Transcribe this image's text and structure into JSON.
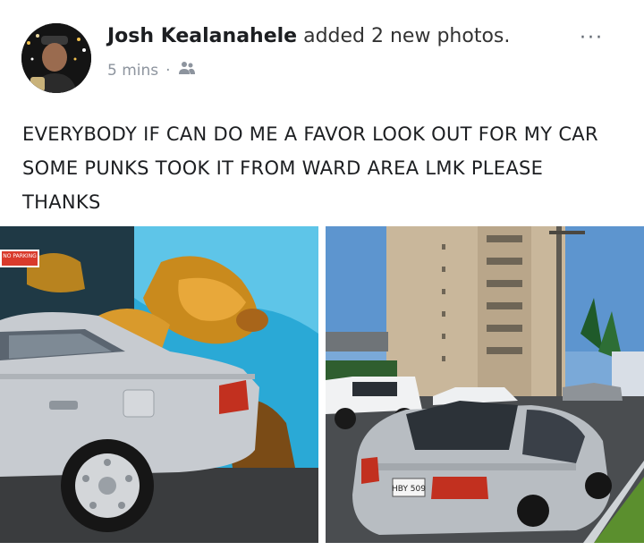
{
  "post": {
    "author": "Josh Kealanahele",
    "action": "added 2 new photos.",
    "timestamp": "5 mins",
    "separator": "·",
    "audience_icon": "friends-icon",
    "more_label": "···",
    "message": "EVERYBODY IF CAN DO ME A FAVOR LOOK OUT FOR MY CAR SOME PUNKS TOOK IT FROM WARD AREA LMK PLEASE THANKS"
  },
  "photos": {
    "left": {
      "sign_text": "NO PARKING"
    },
    "right": {
      "plate_text": "HBY 509"
    }
  }
}
